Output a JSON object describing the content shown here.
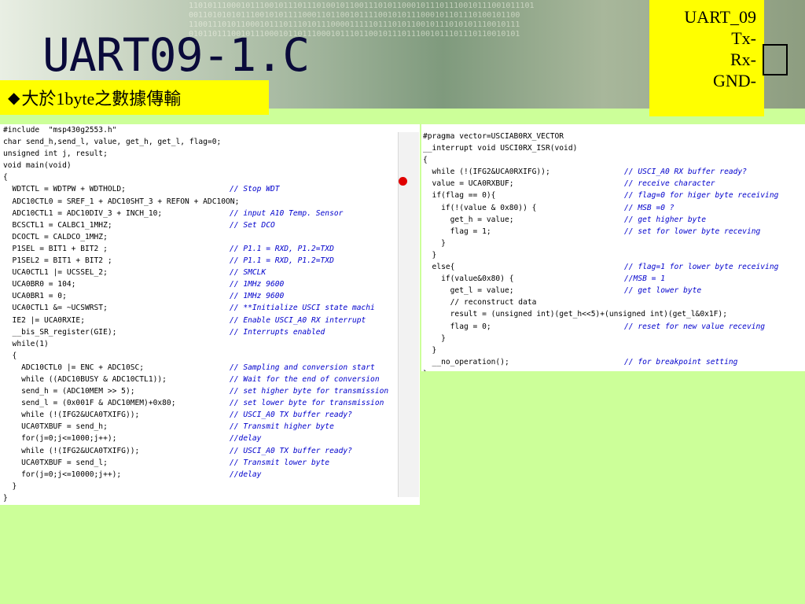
{
  "slide": {
    "title": "UART09-1.C",
    "subtitle": "大於1byte之數據傳輸",
    "subtitle_bullet": "◆",
    "pins": [
      "UART_09",
      "Tx-",
      "Rx-",
      "GND-"
    ]
  },
  "colors": {
    "background": "#ccff99",
    "highlight_box": "#ffff00",
    "comment": "#0000cc",
    "breakpoint": "#e00000"
  },
  "icons": [
    "breakpoint-dot-icon",
    "fold-collapse-icon"
  ],
  "left_code": [
    {
      "code": "#include  \"msp430g2553.h\"",
      "comment": ""
    },
    {
      "code": "char send_h,send_l, value, get_h, get_l, flag=0;",
      "comment": ""
    },
    {
      "code": "unsigned int j, result;",
      "comment": ""
    },
    {
      "code": "void main(void)",
      "comment": ""
    },
    {
      "code": "{",
      "comment": ""
    },
    {
      "code": "  WDTCTL = WDTPW + WDTHOLD;",
      "comment": "// Stop WDT"
    },
    {
      "code": "  ADC10CTL0 = SREF_1 + ADC10SHT_3 + REFON + ADC10ON;",
      "comment": ""
    },
    {
      "code": "  ADC10CTL1 = ADC10DIV_3 + INCH_10;",
      "comment": "// input A10 Temp. Sensor"
    },
    {
      "code": "  BCSCTL1 = CALBC1_1MHZ;",
      "comment": "// Set DCO"
    },
    {
      "code": "  DCOCTL = CALDCO_1MHZ;",
      "comment": ""
    },
    {
      "code": "  P1SEL = BIT1 + BIT2 ;",
      "comment": "// P1.1 = RXD, P1.2=TXD"
    },
    {
      "code": "  P1SEL2 = BIT1 + BIT2 ;",
      "comment": "// P1.1 = RXD, P1.2=TXD"
    },
    {
      "code": "  UCA0CTL1 |= UCSSEL_2;",
      "comment": "// SMCLK"
    },
    {
      "code": "  UCA0BR0 = 104;",
      "comment": "// 1MHz 9600"
    },
    {
      "code": "  UCA0BR1 = 0;",
      "comment": "// 1MHz 9600"
    },
    {
      "code": "  UCA0CTL1 &= ~UCSWRST;",
      "comment": "// **Initialize USCI state machi"
    },
    {
      "code": "  IE2 |= UCA0RXIE;",
      "comment": "// Enable USCI_A0 RX interrupt"
    },
    {
      "code": "  __bis_SR_register(GIE);",
      "comment": "// Interrupts enabled"
    },
    {
      "code": "  while(1)",
      "comment": ""
    },
    {
      "code": "  {",
      "comment": ""
    },
    {
      "code": "    ADC10CTL0 |= ENC + ADC10SC;",
      "comment": "// Sampling and conversion start"
    },
    {
      "code": "    while ((ADC10BUSY & ADC10CTL1));",
      "comment": "// Wait for the end of conversion"
    },
    {
      "code": "    send_h = (ADC10MEM >> 5);",
      "comment": "// set higher byte for transmission"
    },
    {
      "code": "    send_l = (0x001F & ADC10MEM)+0x80;",
      "comment": "// set lower byte for transmission"
    },
    {
      "code": "    while (!(IFG2&UCA0TXIFG));",
      "comment": "// USCI_A0 TX buffer ready?"
    },
    {
      "code": "    UCA0TXBUF = send_h;",
      "comment": "// Transmit higher byte"
    },
    {
      "code": "    for(j=0;j<=1000;j++);",
      "comment": "//delay"
    },
    {
      "code": "    while (!(IFG2&UCA0TXIFG));",
      "comment": "// USCI_A0 TX buffer ready?"
    },
    {
      "code": "    UCA0TXBUF = send_l;",
      "comment": "// Transmit lower byte"
    },
    {
      "code": "    for(j=0;j<=10000;j++);",
      "comment": "//delay"
    },
    {
      "code": "  }",
      "comment": ""
    },
    {
      "code": "}",
      "comment": ""
    }
  ],
  "right_code": [
    {
      "code": "#pragma vector=USCIAB0RX_VECTOR",
      "comment": ""
    },
    {
      "code": "__interrupt void USCI0RX_ISR(void)",
      "comment": ""
    },
    {
      "code": "{",
      "comment": ""
    },
    {
      "code": "  while (!(IFG2&UCA0RXIFG));",
      "comment": "// USCI_A0 RX buffer ready?"
    },
    {
      "code": "  value = UCA0RXBUF;",
      "comment": "// receive character"
    },
    {
      "code": "  if(flag == 0){",
      "comment": "// flag=0 for higer byte receiving"
    },
    {
      "code": "    if(!(value & 0x80)) {",
      "comment": "// MSB =0 ?"
    },
    {
      "code": "      get_h = value;",
      "comment": "// get higher byte"
    },
    {
      "code": "      flag = 1;",
      "comment": "// set for lower byte receving"
    },
    {
      "code": "    }",
      "comment": ""
    },
    {
      "code": "  }",
      "comment": ""
    },
    {
      "code": "  else{",
      "comment": "// flag=1 for lower byte receiving"
    },
    {
      "code": "    if(value&0x80) {",
      "comment": "//MSB = 1"
    },
    {
      "code": "      get_l = value;",
      "comment": "// get lower byte"
    },
    {
      "code": "      // reconstruct data",
      "comment": ""
    },
    {
      "code": "      result = (unsigned int)(get_h<<5)+(unsigned int)(get_l&0x1F);",
      "comment": ""
    },
    {
      "code": "      flag = 0;",
      "comment": "// reset for new value receving"
    },
    {
      "code": "    }",
      "comment": ""
    },
    {
      "code": "  }",
      "comment": ""
    },
    {
      "code": "  __no_operation();",
      "comment": "// for breakpoint setting"
    },
    {
      "code": "}",
      "comment": ""
    }
  ]
}
